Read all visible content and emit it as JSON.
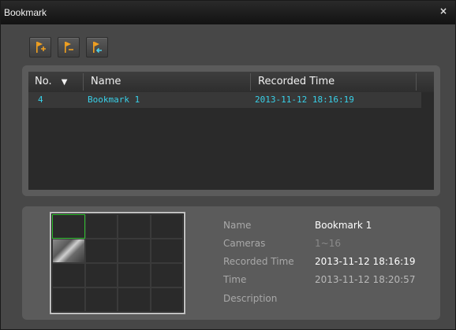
{
  "window": {
    "title": "Bookmark",
    "close_glyph": "×"
  },
  "toolbar": {
    "buttons": [
      {
        "name": "add-bookmark-button",
        "icon": "flag-plus-icon"
      },
      {
        "name": "remove-bookmark-button",
        "icon": "flag-minus-icon"
      },
      {
        "name": "goto-bookmark-button",
        "icon": "flag-arrow-icon"
      }
    ],
    "icon_color": "#f0a020"
  },
  "table": {
    "columns": [
      "No.",
      "Name",
      "Recorded Time"
    ],
    "sort_indicator": "▼",
    "rows": [
      {
        "no": "4",
        "name": "Bookmark 1",
        "recorded_time": "2013-11-12  18:16:19"
      }
    ],
    "row_text_color": "#38d0e8"
  },
  "details": {
    "name_label": "Name",
    "name_value": "Bookmark 1",
    "cameras_label": "Cameras",
    "cameras_value": "1~16",
    "recorded_label": "Recorded Time",
    "recorded_value": "2013-11-12  18:16:19",
    "time_label": "Time",
    "time_value": "2013-11-12  18:20:57",
    "description_label": "Description",
    "description_value": ""
  },
  "thumbnail": {
    "grid": "4x4",
    "selected_color": "#30c030"
  }
}
